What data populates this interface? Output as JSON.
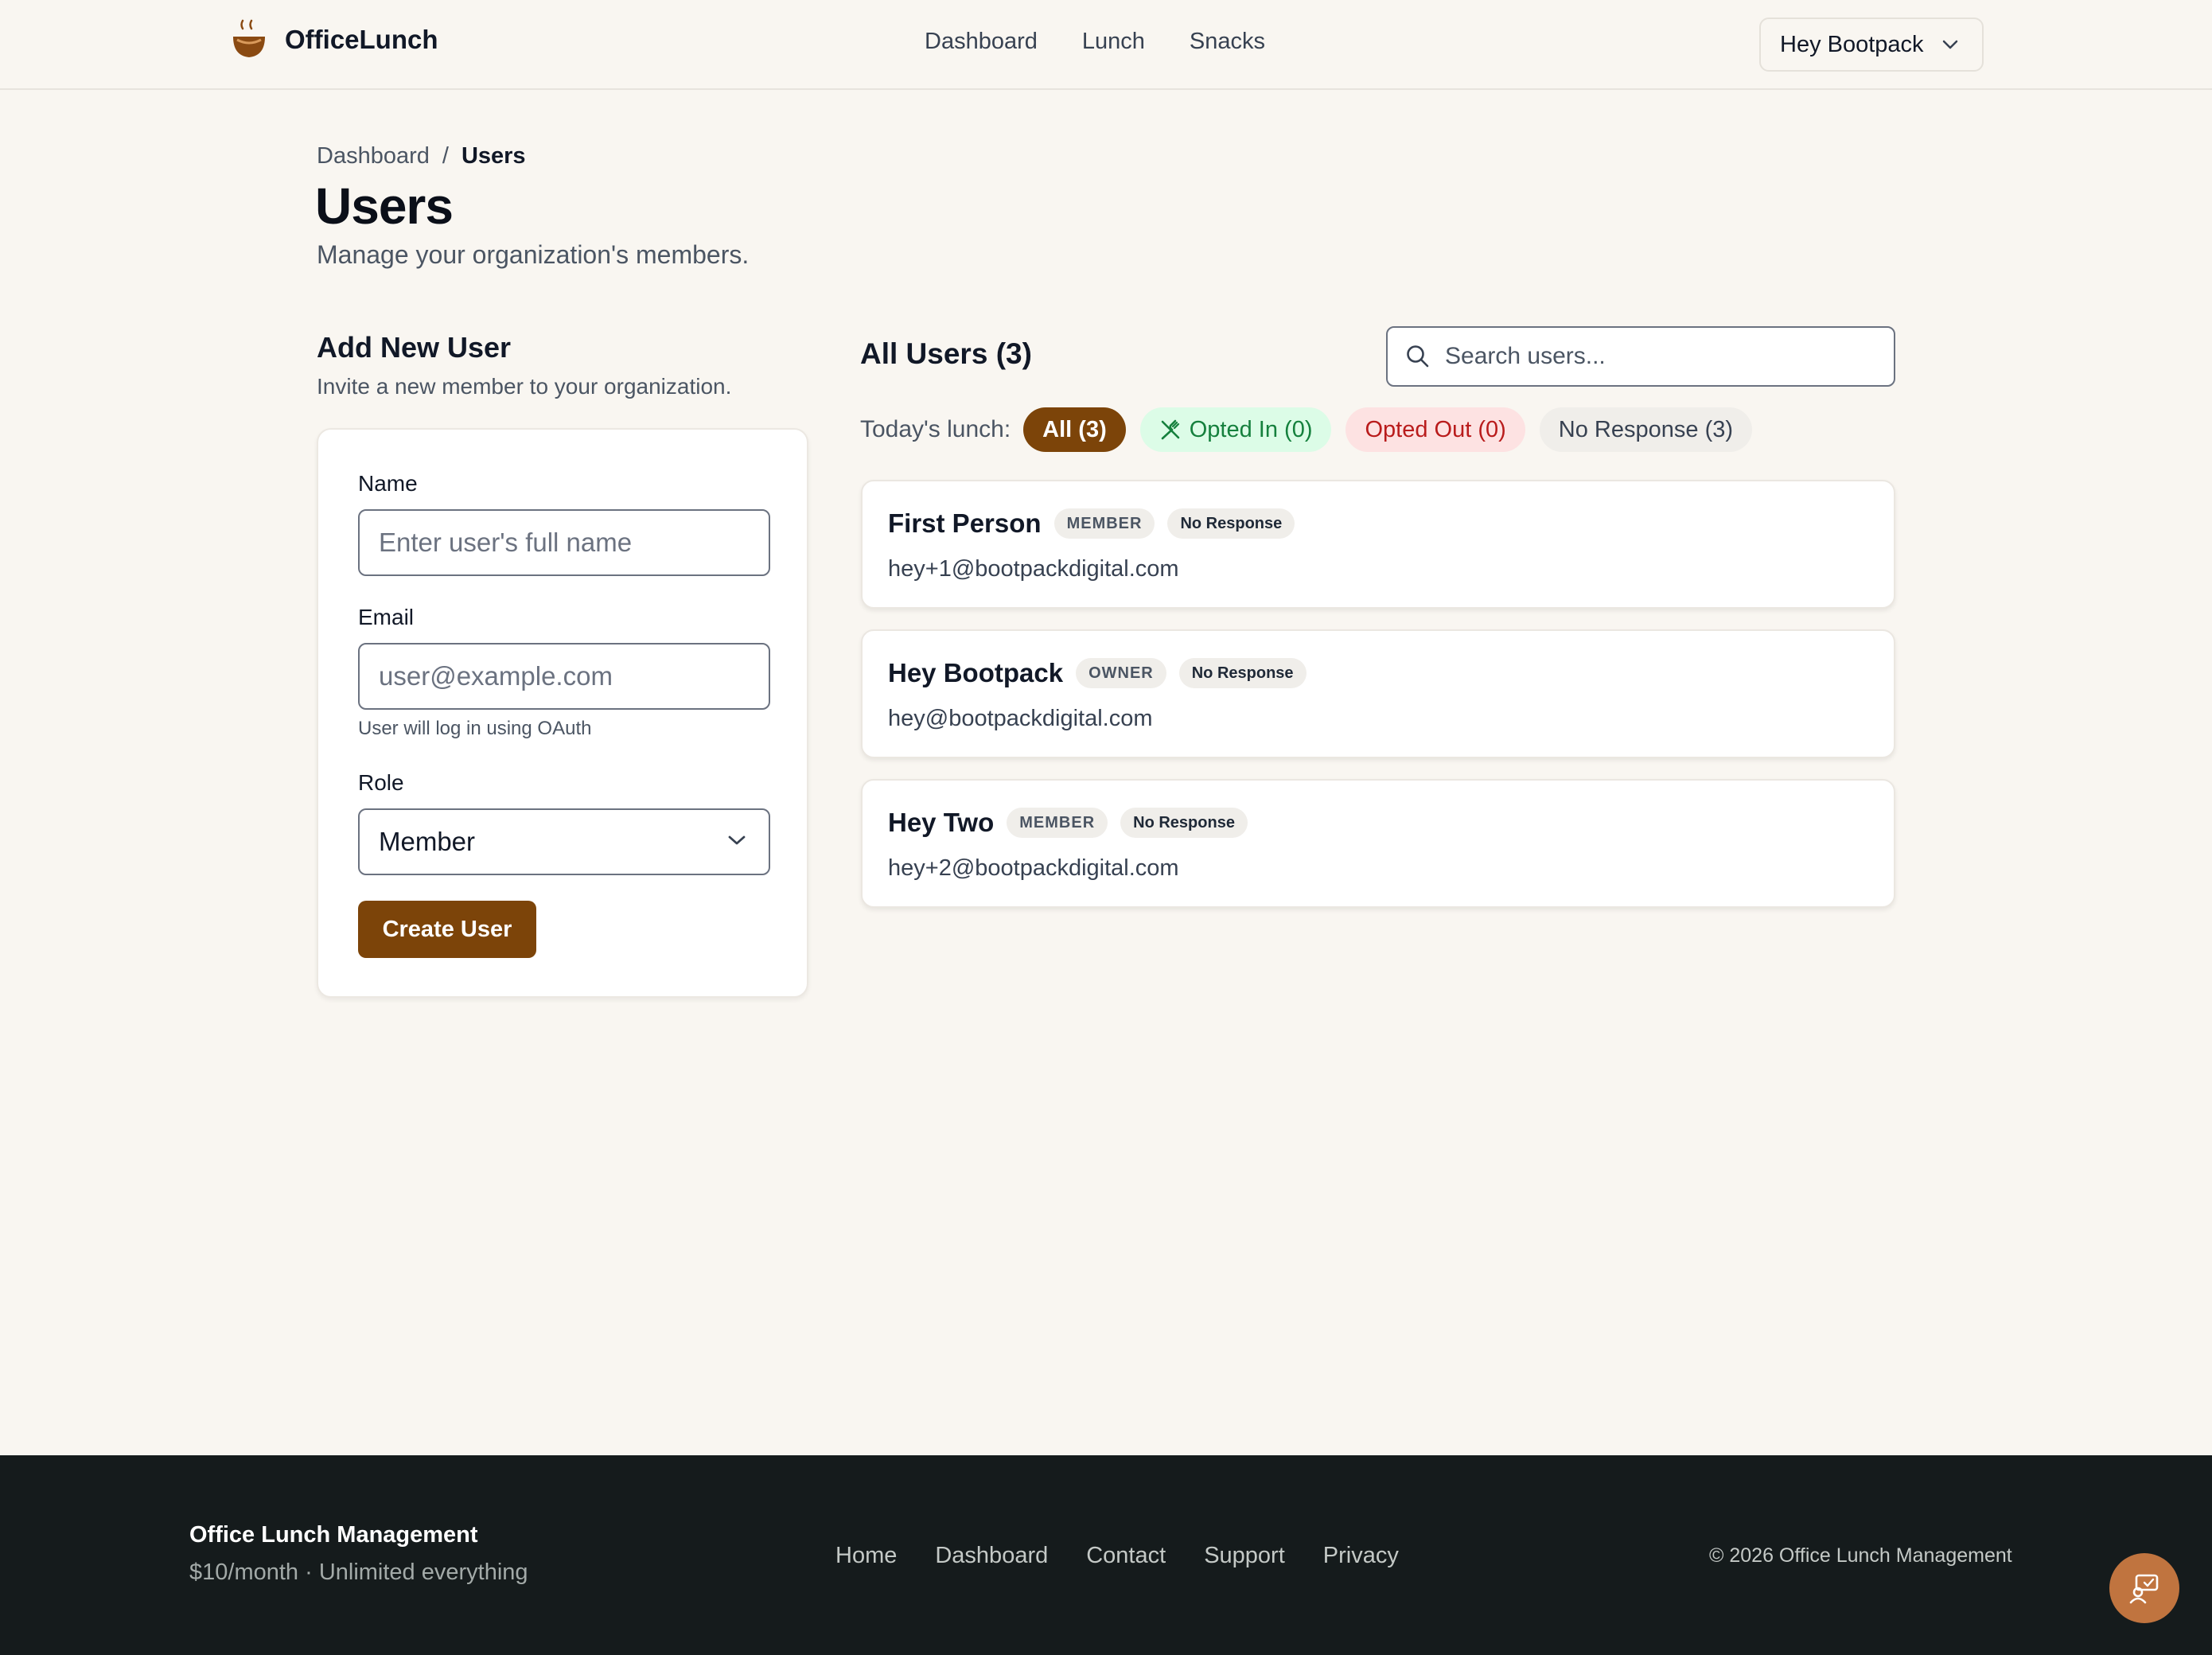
{
  "header": {
    "brand": "OfficeLunch",
    "nav": [
      "Dashboard",
      "Lunch",
      "Snacks"
    ],
    "user_menu": "Hey Bootpack"
  },
  "breadcrumb": {
    "parent": "Dashboard",
    "separator": "/",
    "current": "Users"
  },
  "page": {
    "title": "Users",
    "subtitle": "Manage your organization's members."
  },
  "add_user": {
    "title": "Add New User",
    "description": "Invite a new member to your organization.",
    "name_label": "Name",
    "name_placeholder": "Enter user's full name",
    "email_label": "Email",
    "email_placeholder": "user@example.com",
    "email_help": "User will log in using OAuth",
    "role_label": "Role",
    "role_value": "Member",
    "submit": "Create User"
  },
  "users_list": {
    "title": "All Users (3)",
    "search_placeholder": "Search users...",
    "filter_label": "Today's lunch:",
    "filters": {
      "all": "All (3)",
      "opted_in": "Opted In (0)",
      "opted_out": "Opted Out (0)",
      "no_response": "No Response (3)"
    },
    "users": [
      {
        "name": "First Person",
        "role": "MEMBER",
        "status": "No Response",
        "email": "hey+1@bootpackdigital.com"
      },
      {
        "name": "Hey Bootpack",
        "role": "OWNER",
        "status": "No Response",
        "email": "hey@bootpackdigital.com"
      },
      {
        "name": "Hey Two",
        "role": "MEMBER",
        "status": "No Response",
        "email": "hey+2@bootpackdigital.com"
      }
    ]
  },
  "footer": {
    "title": "Office Lunch Management",
    "subtitle": "$10/month · Unlimited everything",
    "links": [
      "Home",
      "Dashboard",
      "Contact",
      "Support",
      "Privacy"
    ],
    "copyright": "© 2026 Office Lunch Management"
  },
  "colors": {
    "background": "#f9f6f1",
    "accent": "#7c4409",
    "footer": "#151b1c",
    "opted_in_text": "#15803d",
    "opted_out_text": "#b91c1c",
    "fab": "#c0743f"
  },
  "icons": {
    "brand": "bowl-steam-icon",
    "user_menu": "chevron-down-icon",
    "search": "search-icon",
    "opted_in": "utensils-crossed-icon",
    "role_select": "chevron-down-icon",
    "fab": "feedback-chat-icon"
  }
}
